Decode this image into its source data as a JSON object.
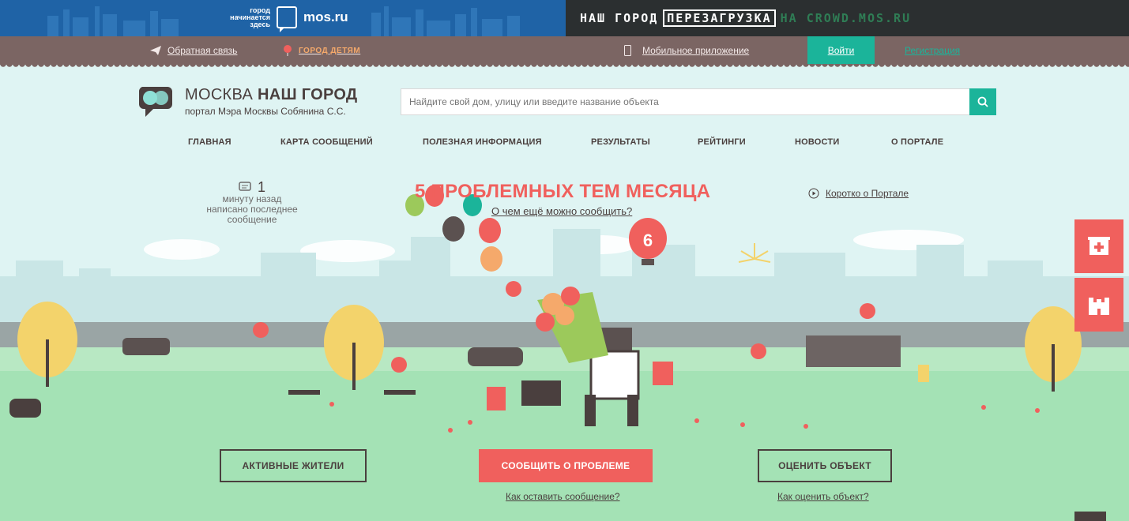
{
  "banner": {
    "mos_tagline": [
      "город",
      "начинается",
      "здесь"
    ],
    "mos_name": "mos.ru",
    "crowd_part1": "НАШ ГОРОД",
    "crowd_part2": "ПЕРЕЗАГРУЗКА",
    "crowd_part3": "НА CROWD.MOS.RU"
  },
  "topnav": {
    "feedback": "Обратная связь",
    "kids": "ГОРОД ДЕТЯМ",
    "mobile_app": "Мобильное приложение",
    "login": "Войти",
    "register": "Регистрация"
  },
  "header": {
    "logo_title_light": "МОСКВА ",
    "logo_title_bold": "НАШ ГОРОД",
    "logo_subtitle": "портал Мэра Москвы Собянина С.С.",
    "search_placeholder": "Найдите свой дом, улицу или введите название объекта"
  },
  "nav": [
    "ГЛАВНАЯ",
    "КАРТА СООБЩЕНИЙ",
    "ПОЛЕЗНАЯ ИНФОРМАЦИЯ",
    "РЕЗУЛЬТАТЫ",
    "РЕЙТИНГИ",
    "НОВОСТИ",
    "О ПОРТАЛЕ"
  ],
  "last_message": {
    "count": "1",
    "lines": [
      "минуту назад",
      "написано последнее",
      "сообщение"
    ]
  },
  "hero": {
    "headline": "5 ПРОБЛЕМНЫХ ТЕМ МЕСЯЦА",
    "sub_link": "О чем ещё можно сообщить?",
    "about_link": "Коротко о Портале",
    "balloon_number": "6"
  },
  "actions": {
    "active_residents": "АКТИВНЫЕ ЖИТЕЛИ",
    "report_problem": "СООБЩИТЬ О ПРОБЛЕМЕ",
    "rate_object": "ОЦЕНИТЬ ОБЪЕКТ",
    "how_to_report": "Как оставить сообщение?",
    "how_to_rate": "Как оценить объект?"
  },
  "colors": {
    "accent": "#1bb49a",
    "primary": "#f0605d",
    "brown": "#7b6563",
    "mos_blue": "#1f63a6",
    "dark": "#2b2f30",
    "ground": "#a4e2b5",
    "sky": "#dff4f3"
  },
  "icons": {
    "feedback": "paper-plane-icon",
    "kids": "balloon-icon",
    "mobile": "phone-icon",
    "search": "search-icon",
    "comment": "comment-icon",
    "play": "play-icon",
    "hospital": "hospital-icon",
    "school": "school-icon"
  }
}
